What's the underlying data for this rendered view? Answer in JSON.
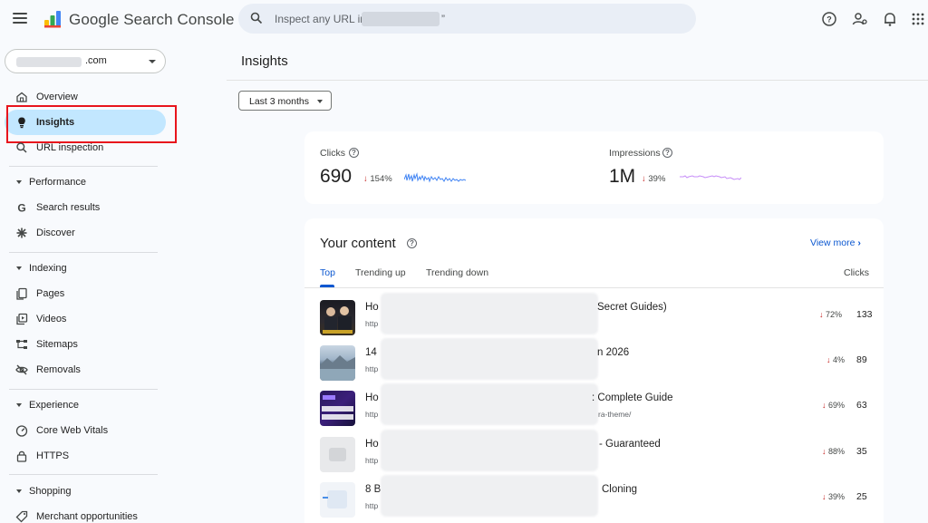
{
  "header": {
    "brand": "Google Search Console",
    "search_placeholder": "Inspect any URL in",
    "search_suffix": "”"
  },
  "sidebar": {
    "property_suffix": ".com",
    "items": [
      {
        "label": "Overview",
        "icon": "home-icon"
      },
      {
        "label": "Insights",
        "icon": "lightbulb-icon",
        "active": true
      },
      {
        "label": "URL inspection",
        "icon": "search-icon"
      }
    ],
    "sections": [
      {
        "label": "Performance",
        "items": [
          {
            "label": "Search results",
            "icon": "google-g-icon"
          },
          {
            "label": "Discover",
            "icon": "asterisk-icon"
          }
        ]
      },
      {
        "label": "Indexing",
        "items": [
          {
            "label": "Pages",
            "icon": "pages-icon"
          },
          {
            "label": "Videos",
            "icon": "videos-icon"
          },
          {
            "label": "Sitemaps",
            "icon": "sitemap-icon"
          },
          {
            "label": "Removals",
            "icon": "eye-off-icon"
          }
        ]
      },
      {
        "label": "Experience",
        "items": [
          {
            "label": "Core Web Vitals",
            "icon": "speedometer-icon"
          },
          {
            "label": "HTTPS",
            "icon": "lock-icon"
          }
        ]
      },
      {
        "label": "Shopping",
        "items": [
          {
            "label": "Merchant opportunities",
            "icon": "tag-icon"
          }
        ]
      }
    ]
  },
  "main": {
    "title": "Insights",
    "date_range": "Last 3 months",
    "metrics": [
      {
        "label": "Clicks",
        "value": "690",
        "change": "154%",
        "direction": "down",
        "color": "#4285f4"
      },
      {
        "label": "Impressions",
        "value": "1M",
        "change": "39%",
        "direction": "down",
        "color": "#a142f4"
      }
    ],
    "your_content": {
      "title": "Your content",
      "view_more": "View more",
      "tabs": [
        "Top",
        "Trending up",
        "Trending down"
      ],
      "active_tab": "Top",
      "clicks_header": "Clicks",
      "rows": [
        {
          "title_start": "Ho",
          "title_end": "Secret Guides)",
          "url_start": "http",
          "url_end": "",
          "change": "72%",
          "clicks": "133"
        },
        {
          "title_start": "14",
          "title_end": "n 2026",
          "url_start": "http",
          "url_end": "",
          "change": "4%",
          "clicks": "89"
        },
        {
          "title_start": "Ho",
          "title_end": ": Complete Guide",
          "url_start": "http",
          "url_end": "ra-theme/",
          "change": "69%",
          "clicks": "63"
        },
        {
          "title_start": "Ho",
          "title_end": "- Guaranteed",
          "url_start": "http",
          "url_end": "",
          "change": "88%",
          "clicks": "35"
        },
        {
          "title_start": "8 B",
          "title_end": "Cloning",
          "url_start": "http",
          "url_end": "",
          "change": "39%",
          "clicks": "25"
        }
      ]
    }
  },
  "colors": {
    "accent": "#0b57d0",
    "active_nav": "#c2e7ff",
    "highlight_box": "#e8141c",
    "down_arrow": "#c5221f"
  }
}
